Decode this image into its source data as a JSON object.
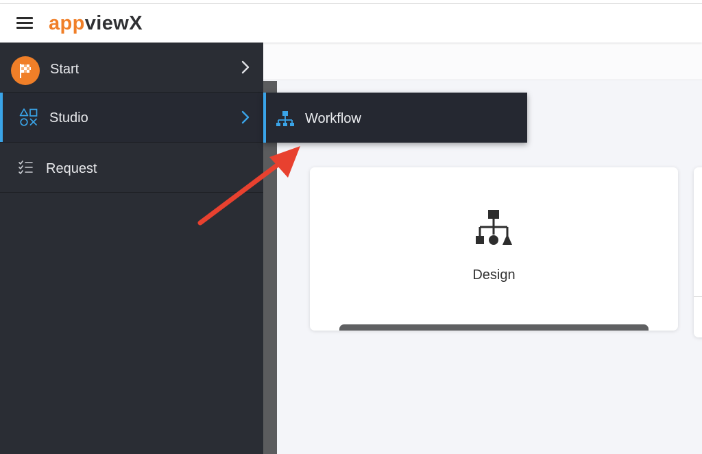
{
  "header": {
    "logo_part1": "app",
    "logo_part2": "viewX",
    "menu_icon": "hamburger-menu-icon"
  },
  "sidebar": {
    "items": [
      {
        "label": "Start",
        "icon": "checkered-flag-icon",
        "has_submenu": true,
        "active": false
      },
      {
        "label": "Studio",
        "icon": "shapes-icon",
        "has_submenu": true,
        "active": true
      },
      {
        "label": "Request",
        "icon": "checklist-icon",
        "has_submenu": false,
        "active": false
      }
    ]
  },
  "flyout": {
    "items": [
      {
        "label": "Workflow",
        "icon": "workflow-hierarchy-icon"
      }
    ]
  },
  "cards": [
    {
      "label": "Design",
      "icon": "design-hierarchy-icon"
    }
  ],
  "annotation": {
    "type": "arrow",
    "color": "#e8412f",
    "points_to": "Workflow"
  },
  "colors": {
    "brand_orange": "#f07f28",
    "logo_dark": "#2f3033",
    "sidebar_bg": "#2a2d34",
    "accent_blue": "#3aa4e8",
    "content_bg": "#f4f5f9",
    "arrow_red": "#e8412f"
  }
}
